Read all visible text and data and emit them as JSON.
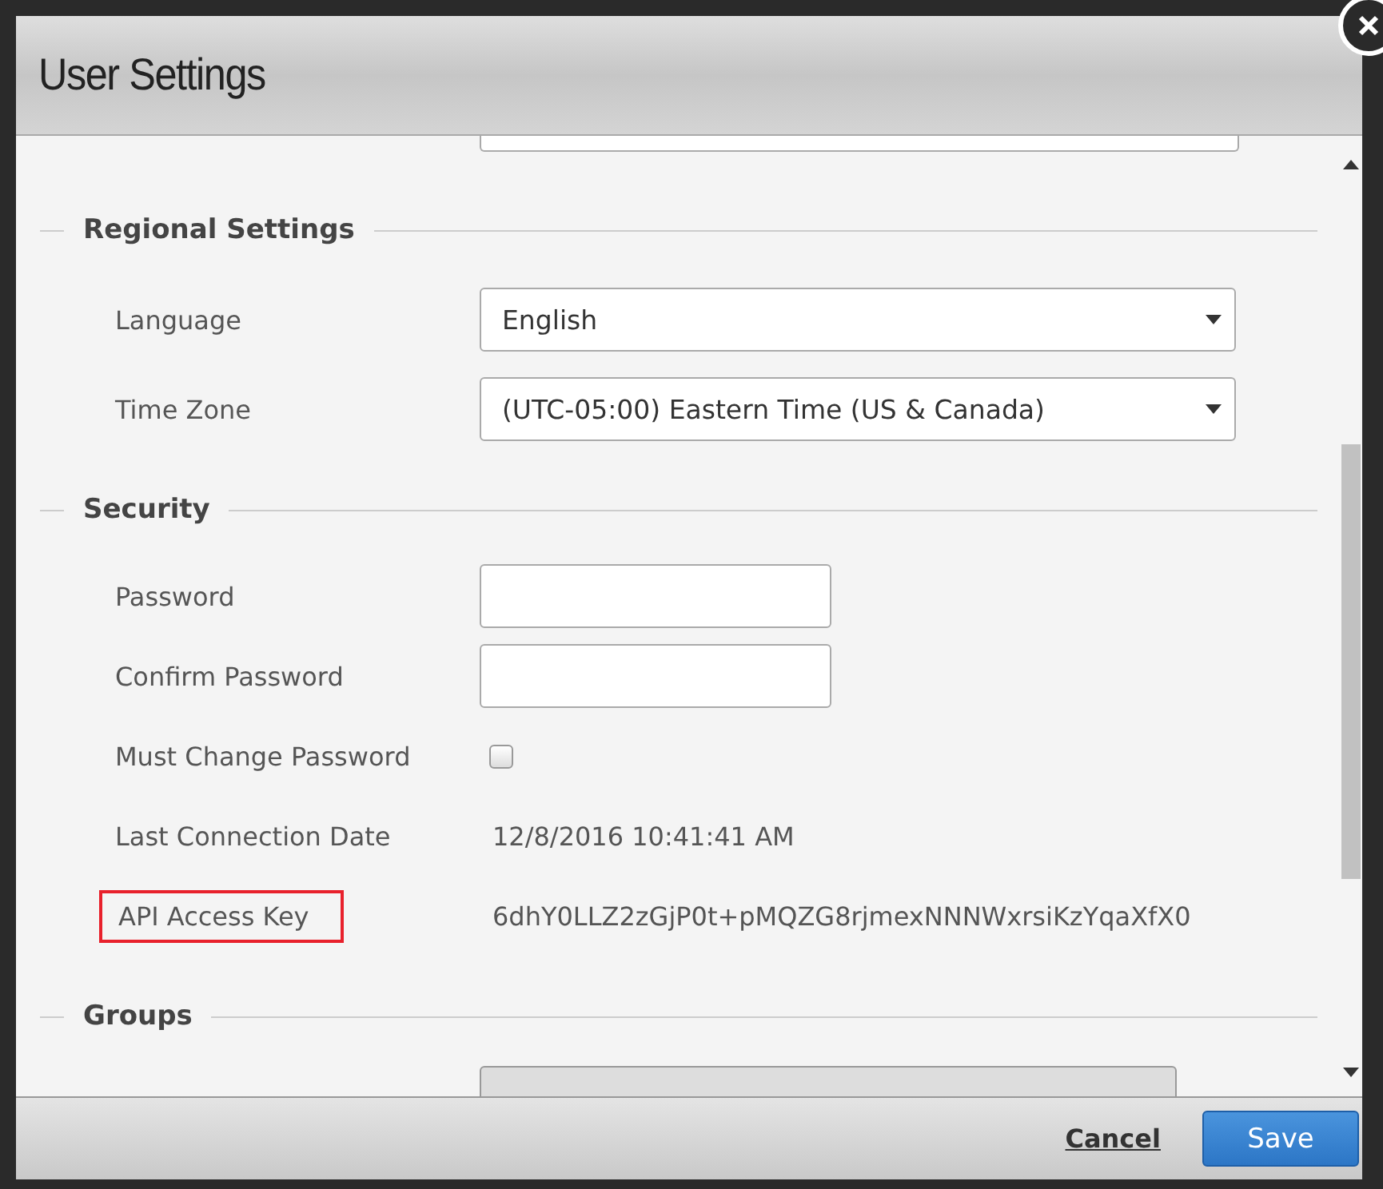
{
  "window": {
    "title": "User Settings"
  },
  "sections": [
    {
      "heading": "Regional Settings",
      "rows": [
        {
          "kind": "select",
          "label": "Language",
          "value": "English"
        },
        {
          "kind": "select",
          "label": "Time Zone",
          "value": "(UTC-05:00) Eastern Time (US & Canada)"
        }
      ]
    },
    {
      "heading": "Security",
      "rows": [
        {
          "kind": "input",
          "label": "Password"
        },
        {
          "kind": "input",
          "label": "Confirm Password"
        },
        {
          "kind": "checkbox",
          "label": "Must Change Password",
          "checked": false
        },
        {
          "kind": "text",
          "label": "Last Connection Date",
          "value": "12/8/2016 10:41:41 AM"
        },
        {
          "kind": "text",
          "label": "API Access Key",
          "value": "6dhY0LLZ2zGjP0t+pMQZG8rjmexNNNWxrsiKzYqaXfX0",
          "highlighted": true
        }
      ]
    },
    {
      "heading": "Groups",
      "rows": [
        {
          "kind": "list"
        }
      ]
    }
  ],
  "footer": {
    "buttons": [
      {
        "kind": "link",
        "label": "Cancel"
      },
      {
        "kind": "primary",
        "label": "Save"
      }
    ]
  }
}
